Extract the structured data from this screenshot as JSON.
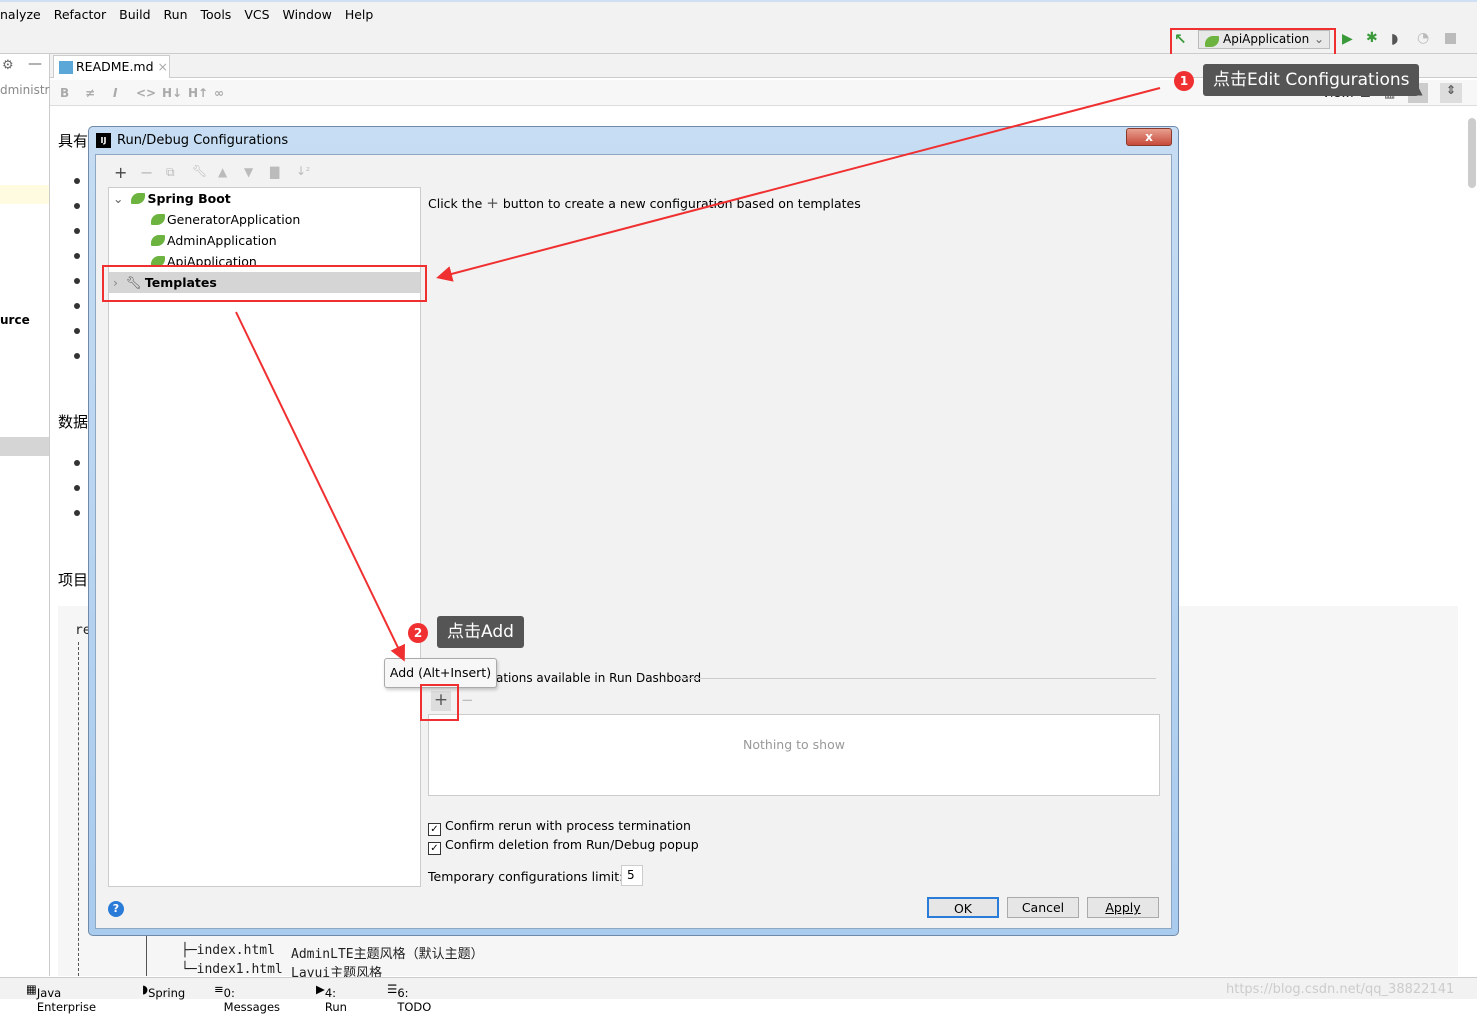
{
  "menu": [
    "nalyze",
    "Refactor",
    "Build",
    "Run",
    "Tools",
    "VCS",
    "Window",
    "Help"
  ],
  "toolbar": {
    "run_config": "ApiApplication",
    "icons": [
      "build-hammer-icon",
      "run-icon",
      "debug-icon",
      "coverage-icon",
      "profile-icon",
      "stop-icon"
    ]
  },
  "editor": {
    "tab": "README.md",
    "left_text": "dministra",
    "left_text2": "urce",
    "md_toolbar": [
      "B",
      "≠",
      "I",
      "<>",
      "H↓",
      "H↑",
      "∞"
    ],
    "view_label": "View:",
    "headings": [
      "具有",
      "数据",
      "项目"
    ],
    "code_prefix": "re",
    "code_lines": [
      {
        "file": "├─index.html",
        "desc": "AdminLTE主题风格（默认主题）"
      },
      {
        "file": "└─index1.html",
        "desc": "Layui主题风格"
      }
    ]
  },
  "annotations": {
    "step1_num": "1",
    "step1_text": "点击Edit Configurations",
    "step2_num": "2",
    "step2_text": "点击Add",
    "highlight_color": "#f03030"
  },
  "dialog": {
    "title": "Run/Debug Configurations",
    "close": "x",
    "tree": {
      "group": "Spring Boot",
      "items": [
        "GeneratorApplication",
        "AdminApplication",
        "ApiApplication"
      ],
      "templates": "Templates"
    },
    "hint_pre": "Click the",
    "hint_plus": "+",
    "hint_post": "button to create a new configuration based on templates",
    "tooltip": "Add (Alt+Insert)",
    "dashboard_label": "ations available in Run Dashboard",
    "empty": "Nothing to show",
    "check1": "Confirm rerun with process termination",
    "check2": "Confirm deletion from Run/Debug popup",
    "limit_label": "Temporary configurations limit:",
    "limit_value": "5",
    "ok": "OK",
    "cancel": "Cancel",
    "apply": "Apply",
    "help": "?"
  },
  "status": [
    "Java Enterprise",
    "Spring",
    "0: Messages",
    "4: Run",
    "6: TODO"
  ],
  "watermark": "https://blog.csdn.net/qq_38822141"
}
